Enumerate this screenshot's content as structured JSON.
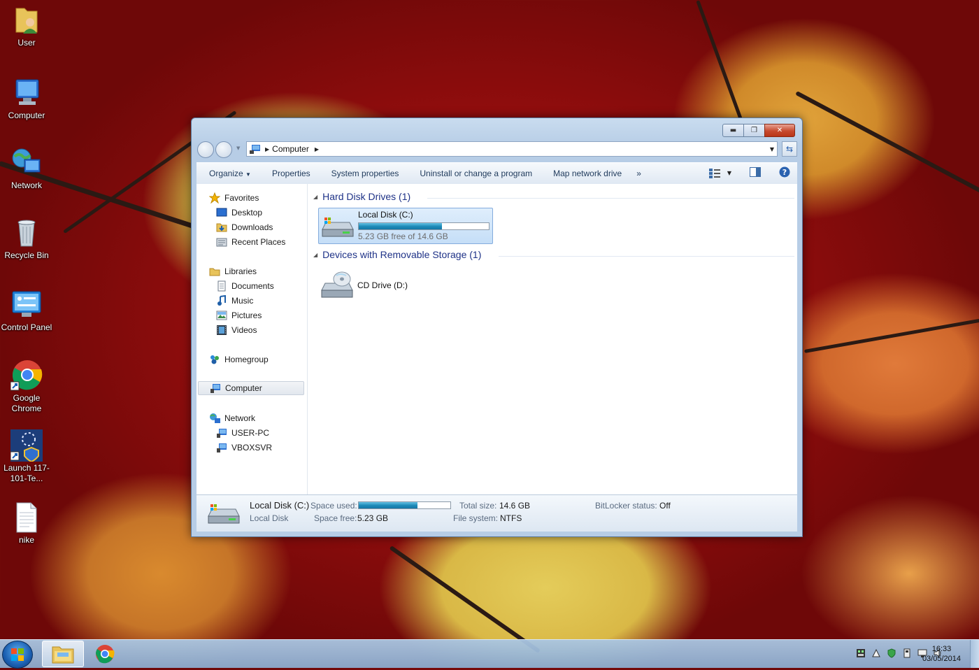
{
  "desktop": {
    "icons": [
      {
        "label": "User"
      },
      {
        "label": "Computer"
      },
      {
        "label": "Network"
      },
      {
        "label": "Recycle Bin"
      },
      {
        "label": "Control Panel"
      },
      {
        "label": "Google Chrome"
      },
      {
        "label": "Launch 117-101-Te..."
      },
      {
        "label": "nike"
      }
    ]
  },
  "window": {
    "address": {
      "current": "Computer"
    },
    "toolbar": {
      "organize": "Organize",
      "properties": "Properties",
      "system_properties": "System properties",
      "uninstall": "Uninstall or change a program",
      "map_drive": "Map network drive",
      "more": "»"
    },
    "nav": {
      "favorites": "Favorites",
      "desktop": "Desktop",
      "downloads": "Downloads",
      "recent": "Recent Places",
      "libraries": "Libraries",
      "documents": "Documents",
      "music": "Music",
      "pictures": "Pictures",
      "videos": "Videos",
      "homegroup": "Homegroup",
      "computer": "Computer",
      "network": "Network",
      "user_pc": "USER-PC",
      "vboxsvr": "VBOXSVR"
    },
    "groups": {
      "hdd": "Hard Disk Drives (1)",
      "removable": "Devices with Removable Storage (1)"
    },
    "drives": {
      "c": {
        "name": "Local Disk (C:)",
        "free_text": "5.23 GB free of 14.6 GB",
        "used_fraction": 0.64
      },
      "d": {
        "name": "CD Drive (D:)"
      }
    },
    "details": {
      "name": "Local Disk (C:)",
      "type": "Local Disk",
      "space_used_label": "Space used:",
      "space_free_label": "Space free:",
      "space_free": "5.23 GB",
      "total_size_label": "Total size:",
      "total_size": "14.6 GB",
      "file_system_label": "File system:",
      "file_system": "NTFS",
      "bitlocker_label": "BitLocker status:",
      "bitlocker": "Off",
      "used_fraction": 0.64
    }
  },
  "taskbar": {
    "time": "16:33",
    "date": "03/05/2014"
  }
}
